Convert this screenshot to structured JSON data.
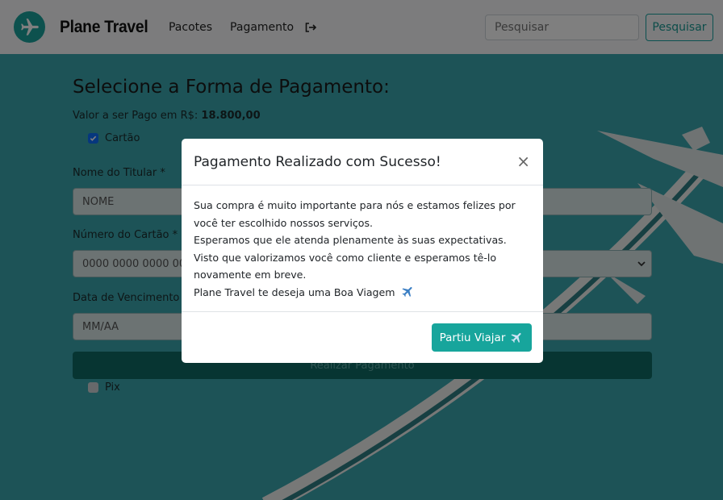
{
  "navbar": {
    "brand": "Plane Travel",
    "links": [
      "Pacotes",
      "Pagamento"
    ],
    "search_placeholder": "Pesquisar",
    "search_button": "Pesquisar"
  },
  "page": {
    "title": "Selecione a Forma de Pagamento:",
    "amount_prefix": "Valor a ser Pago em R$:",
    "amount_value": "18.800,00",
    "option_card": "Cartão",
    "option_card_checked": true,
    "holder_label": "Nome do Titular *",
    "holder_placeholder": "NOME",
    "card_number_label": "Número do Cartão *",
    "card_number_placeholder": "0000 0000 0000 0000",
    "expiry_label": "Data de Vencimento *",
    "expiry_placeholder": "MM/AA",
    "submit_button": "Realizar Pagamento",
    "option_pix": "Pix",
    "option_pix_checked": false
  },
  "modal": {
    "title": "Pagamento Realizado com Sucesso!",
    "close": "×",
    "body": [
      "Sua compra é muito importante para nós e estamos felizes por você ter escolhido nossos serviços.",
      "Esperamos que ele atenda plenamente às suas expectativas. Visto que valorizamos você como cliente e esperamos tê-lo novamente em breve.",
      "Plane Travel te deseja uma Boa Viagem"
    ],
    "confirm_button": "Partiu Viajar"
  },
  "colors": {
    "brand_teal": "#1aa39c",
    "background": "#3aa7ae",
    "backdrop": "rgba(0,0,0,0.5)"
  },
  "icons": [
    "airplane-logo-icon",
    "logout-icon",
    "checkbox-icon",
    "chevron-down-icon",
    "close-icon",
    "airplane-emoji-icon"
  ]
}
